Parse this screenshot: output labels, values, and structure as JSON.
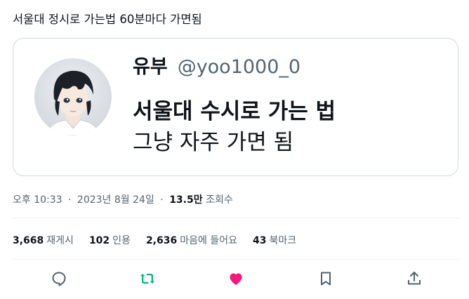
{
  "tweet": {
    "text": "서울대 정시로 가는법 60분마다 가면됨"
  },
  "quote": {
    "display_name": "유부",
    "handle": "@yoo1000_0",
    "line1": "서울대 수시로 가는 법",
    "line2": "그냥 자주 가면 됨"
  },
  "meta": {
    "time": "오후 10:33",
    "separator": "·",
    "date": "2023년 8월 24일",
    "views_count": "13.5만",
    "views_label": "조회수"
  },
  "stats": {
    "retweets_count": "3,668",
    "retweets_label": "재게시",
    "quotes_count": "102",
    "quotes_label": "인용",
    "likes_count": "2,636",
    "likes_label": "마음에 들어요",
    "bookmarks_count": "43",
    "bookmarks_label": "북마크"
  },
  "actions": [
    {
      "icon": "reply-icon",
      "color": "#536471"
    },
    {
      "icon": "retweet-icon",
      "color": "#00ba7c"
    },
    {
      "icon": "heart-icon",
      "color": "#f91880"
    },
    {
      "icon": "bookmark-icon",
      "color": "#536471"
    },
    {
      "icon": "share-icon",
      "color": "#536471"
    }
  ],
  "colors": {
    "text": "#0f1419",
    "secondary": "#536471",
    "border": "#cfd9de",
    "retweet_active": "#00ba7c",
    "like_active": "#f91880"
  }
}
